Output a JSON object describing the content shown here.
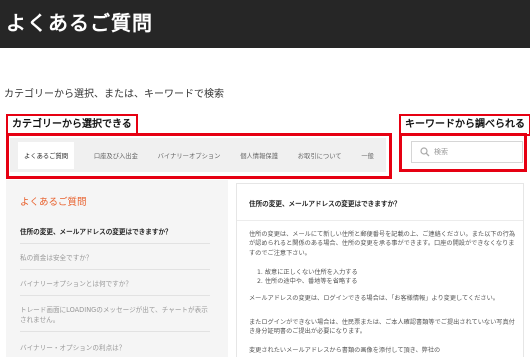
{
  "header": {
    "title": "よくあるご質問"
  },
  "subtitle": "カテゴリーから選択、または、キーワードで検索",
  "callouts": {
    "category": "カテゴリーから選択できる",
    "keyword": "キーワードから調べられる"
  },
  "tabs": [
    {
      "label": "よくあるご質問"
    },
    {
      "label": "口座及び入出金"
    },
    {
      "label": "バイナリーオプション"
    },
    {
      "label": "個人情報保護"
    },
    {
      "label": "お取引について"
    },
    {
      "label": "一般"
    }
  ],
  "search": {
    "placeholder": "検索",
    "icon": "search-icon"
  },
  "faq_panel": {
    "title": "よくあるご質問",
    "items": [
      "住所の変更、メールアドレスの変更はできますか？",
      "私の資金は安全ですか？",
      "バイナリーオプションとは何ですか？",
      "トレード画面にLOADINGのメッセージが出て、チャートが表示されません。",
      "バイナリー・オプションの利点は？"
    ]
  },
  "answer_panel": {
    "title": "住所の変更、メールアドレスの変更はできますか？",
    "paragraph1": "住所の変更は、メールにて新しい住所と郵便番号を記載の上、ご連絡ください。また以下の行為が認められると関係のある場合、住所の変更を承る事ができます。口座の開設ができなくなりますのでご注意下さい。",
    "list": [
      "1. 故意に正しくない住所を入力する",
      "2. 住所の途中や、番地等を省略する"
    ],
    "paragraph2": "メールアドレスの変更は、ログインできる場合は、「お客様情報」より変更してください。",
    "paragraph3": "またログインができない場合は、住民票または、ご本人確認書類等でご提出されていない写真付き身分証明書のご提出が必要になります。",
    "paragraph4": "変更されたいメールアドレスから書類の画像を添付して頂き、弊社の"
  }
}
